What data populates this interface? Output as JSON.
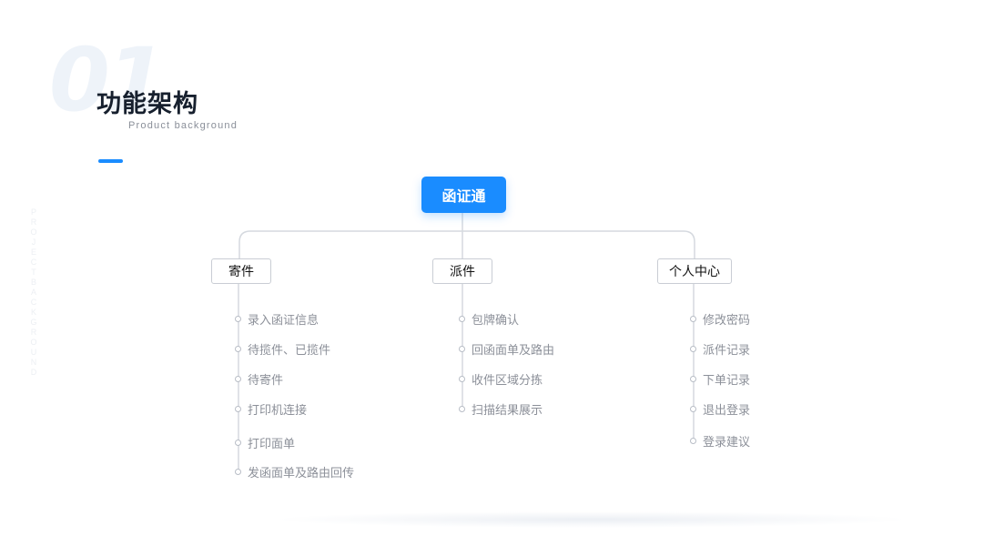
{
  "slide": {
    "number": "01",
    "title": "功能架构",
    "subtitle": "Product background",
    "vertical_text": "PROJECT BACKGROUND",
    "accent_color": "#1a8cff"
  },
  "tree": {
    "root": "函证通",
    "branches": [
      {
        "label": "寄件",
        "items": [
          "录入函证信息",
          "待揽件、已揽件",
          "待寄件",
          "打印机连接",
          "打印面单",
          "发函面单及路由回传"
        ]
      },
      {
        "label": "派件",
        "items": [
          "包牌确认",
          "回函面单及路由",
          "收件区域分拣",
          "扫描结果展示"
        ]
      },
      {
        "label": "个人中心",
        "items": [
          "修改密码",
          "派件记录",
          "下单记录",
          "退出登录",
          "登录建议"
        ]
      }
    ]
  }
}
